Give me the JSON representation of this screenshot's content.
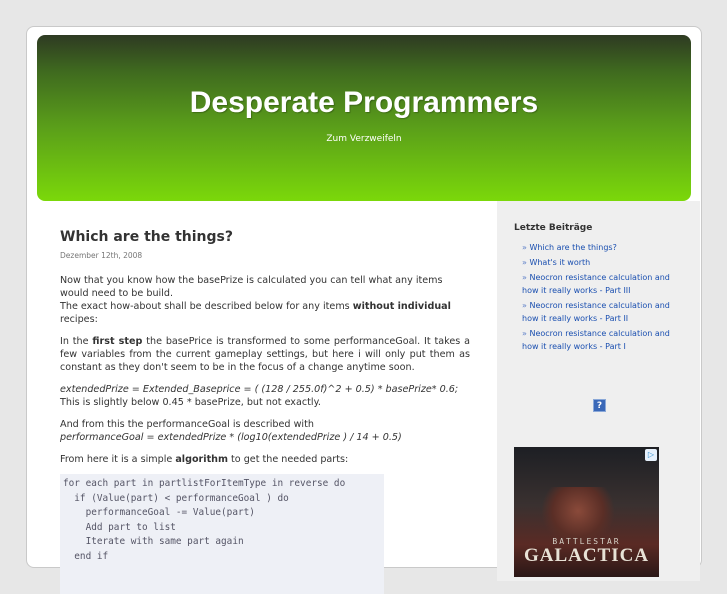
{
  "blog": {
    "title": "Desperate Programmers",
    "description": "Zum Verzweifeln"
  },
  "post": {
    "title": "Which are the things?",
    "date": "Dezember 12th, 2008",
    "p1_a": "Now that you know how the basePrize is calculated you can tell what any items would need to be build.",
    "p1_b": "The exact how-about shall be described below for any items ",
    "p1_b_strong": "without individual",
    "p1_b_end": " recipes:",
    "p2_a": "In the ",
    "p2_strong": "first step",
    "p2_b": " the basePrice is transformed to some performanceGoal. It takes a few variables from the current gameplay settings, but here i will only put them as constant as they don't seem to be in the focus of a change anytime soon.",
    "p3_formula": "extendedPrize = Extended_Baseprice = ( (128 / 255.0f)^2 + 0.5) * basePrize* 0.6;",
    "p3_b": "This is slightly below 0.45 * basePrize, but not exactly.",
    "p4_a": "And from this the performanceGoal is described with",
    "p4_formula": "performanceGoal = extendedPrize * (log10(extendedPrize ) / 14 + 0.5)",
    "p5_a": "From here it is a simple ",
    "p5_strong": "algorithm",
    "p5_b": " to get the needed parts:",
    "code": [
      "for each part in partlistForItemType in reverse do",
      "  if (Value(part) < performanceGoal ) do",
      "    performanceGoal -= Value(part)",
      "    Add part to list",
      "    Iterate with same part again",
      "  end if"
    ]
  },
  "sidebar": {
    "title": "Letzte Beiträge",
    "arrow": "»",
    "items": [
      "Which are the things?",
      "What's it worth",
      "Neocron resistance calculation and how it really works - Part III",
      "Neocron resistance calculation and how it really works - Part II",
      "Neocron resistance calculation and how it really works - Part I"
    ],
    "help_label": "?",
    "ad": {
      "line1": "BATTLESTAR",
      "line2": "GALACTICA",
      "adchoices_icon": "adchoices-icon"
    }
  }
}
